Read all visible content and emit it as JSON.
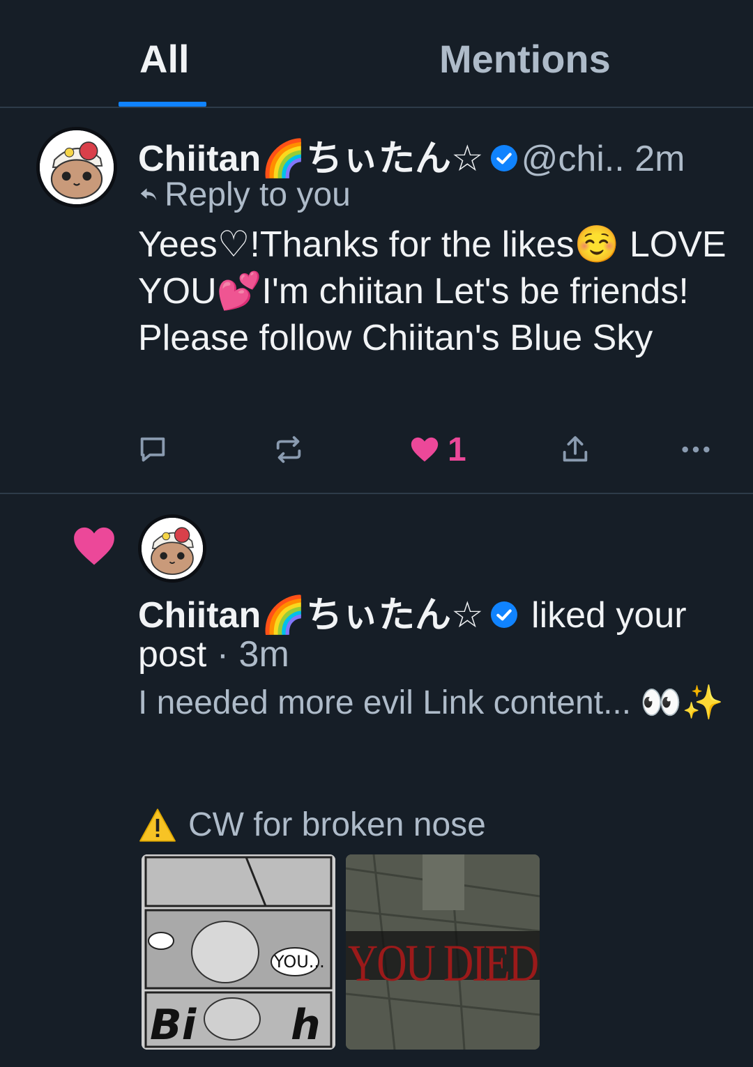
{
  "tabs": [
    {
      "label": "All",
      "active": true
    },
    {
      "label": "Mentions",
      "active": false
    }
  ],
  "post1": {
    "author_name": "Chiitan🌈ちぃたん☆",
    "verified": true,
    "handle": "@chi..",
    "time": "2m",
    "reply_label": "Reply to you",
    "text": "Yees♡!Thanks for the likes☺️ LOVE YOU💕I'm chiitan Let's be friends! Please follow Chiitan's Blue Sky",
    "like_count": "1",
    "liked": true
  },
  "notification": {
    "actor_name": "Chiitan🌈ちぃたん☆",
    "verified": true,
    "action": "liked your post",
    "separator": "·",
    "time": "3m",
    "post_text": "I needed more evil Link content... 👀✨",
    "content_warning": "CW for broken nose",
    "image1_texts": [
      "YOU...",
      "Bi",
      "h"
    ],
    "image2_text": "YOU DIED"
  },
  "colors": {
    "background": "#161e27",
    "accent": "#1083fe",
    "like": "#ec4899",
    "muted": "#aebbc9",
    "verified": "#1083fe"
  },
  "icons": [
    "reply-icon",
    "repost-icon",
    "heart-icon",
    "share-icon",
    "more-icon",
    "verified-badge-icon",
    "reply-arrow-icon",
    "warning-icon"
  ]
}
